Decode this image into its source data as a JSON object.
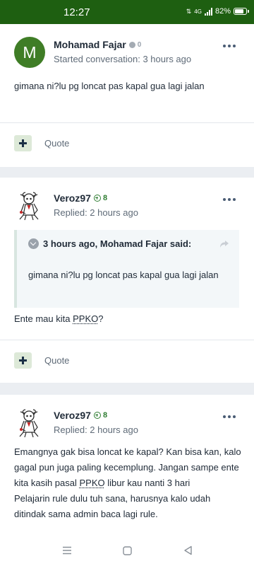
{
  "status_bar": {
    "time": "12:27",
    "battery": "82%",
    "network": "4G"
  },
  "posts": [
    {
      "author": "Mohamad Fajar",
      "avatar_letter": "M",
      "reputation": "0",
      "meta": "Started conversation: 3 hours ago",
      "text": "gimana ni?lu pg loncat pas kapal gua lagi jalan",
      "quote_label": "Quote"
    },
    {
      "author": "Veroz97",
      "reputation": "8",
      "meta": "Replied: 2 hours ago",
      "quote": {
        "header": "3 hours ago, Mohamad Fajar said:",
        "text": "gimana ni?lu pg loncat pas kapal gua lagi jalan"
      },
      "text_prefix": "Ente mau kita ",
      "text_abbr": "PPKO",
      "text_suffix": "?",
      "quote_label": "Quote"
    },
    {
      "author": "Veroz97",
      "reputation": "8",
      "meta": "Replied: 2 hours ago",
      "lines": [
        "Emangnya gak bisa loncat ke kapal? Kan bisa kan, kalo",
        "gagal pun juga paling kecemplung. Jangan sampe ente"
      ],
      "line3_prefix": "kita kasih pasal ",
      "line3_abbr": "PPKO",
      "line3_suffix": " libur kau nanti 3 hari",
      "lines_after": [
        "Pelajarin rule dulu tuh sana, harusnya kalo udah",
        "ditindak sama admin baca lagi rule."
      ]
    }
  ],
  "colors": {
    "status_bar": "#1e5f11",
    "avatar_bg": "#3f7d26",
    "reputation_positive": "#2f7d32",
    "page_bg": "#ebeef2"
  }
}
